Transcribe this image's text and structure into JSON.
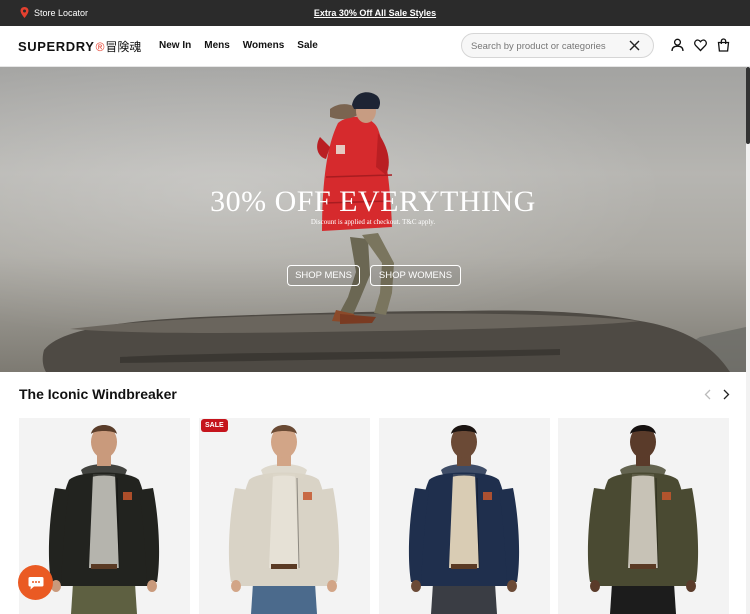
{
  "topbar": {
    "store_locator": "Store Locator",
    "promo": "Extra 30% Off All Sale Styles"
  },
  "header": {
    "logo_text": "SUPERDRY",
    "logo_mark": "®",
    "logo_kanji": "冒険魂",
    "nav": [
      "New In",
      "Mens",
      "Womens",
      "Sale"
    ],
    "search_placeholder": "Search by product or categories",
    "icons": [
      "user-icon",
      "heart-icon",
      "bag-icon"
    ]
  },
  "hero": {
    "headline": "30% OFF EVERYTHING",
    "subline": "Discount is applied at checkout. T&C apply.",
    "btn_mens": "SHOP MENS",
    "btn_womens": "SHOP WOMENS"
  },
  "section": {
    "title": "The Iconic Windbreaker"
  },
  "products": [
    {
      "badge": "",
      "jacket_color": "#22231f",
      "inner_color": "#b5b4ad",
      "trouser_color": "#5e6041"
    },
    {
      "badge": "SALE",
      "jacket_color": "#d9d3c6",
      "inner_color": "#e6e1d6",
      "trouser_color": "#4b6a8c"
    },
    {
      "badge": "",
      "jacket_color": "#1f2f4d",
      "inner_color": "#d9ccb4",
      "trouser_color": "#3a3d44"
    },
    {
      "badge": "",
      "jacket_color": "#4a4a32",
      "inner_color": "#c7c2b6",
      "trouser_color": "#1c1c1c"
    }
  ],
  "colors": {
    "topbar_bg": "#2b2b2b",
    "logo_accent": "#e4402f",
    "sale_badge": "#c5141c",
    "chat_button": "#ea5a23"
  }
}
